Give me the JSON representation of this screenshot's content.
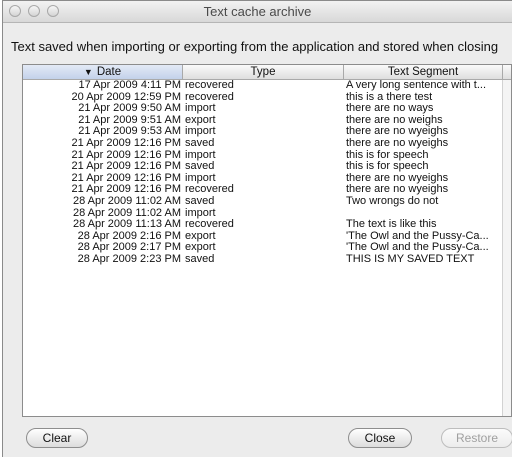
{
  "window": {
    "title": "Text cache archive"
  },
  "description": "Text saved when importing or exporting from the application and stored when closing",
  "table": {
    "columns": [
      "Date",
      "Type",
      "Text Segment"
    ],
    "sort_column": "Date",
    "rows": [
      {
        "date": "17 Apr 2009 4:11 PM",
        "type": "recovered",
        "text": "A very long sentence with t..."
      },
      {
        "date": "20 Apr 2009 12:59 PM",
        "type": "recovered",
        "text": "this is a there test"
      },
      {
        "date": "21 Apr 2009 9:50 AM",
        "type": "import",
        "text": "there are no ways"
      },
      {
        "date": "21 Apr 2009 9:51 AM",
        "type": "export",
        "text": "there are no weighs"
      },
      {
        "date": "21 Apr 2009 9:53 AM",
        "type": "import",
        "text": "there are no wyeighs"
      },
      {
        "date": "21 Apr 2009 12:16 PM",
        "type": "saved",
        "text": "there are no wyeighs"
      },
      {
        "date": "21 Apr 2009 12:16 PM",
        "type": "import",
        "text": "this is for speech"
      },
      {
        "date": "21 Apr 2009 12:16 PM",
        "type": "saved",
        "text": "this is for speech"
      },
      {
        "date": "21 Apr 2009 12:16 PM",
        "type": "import",
        "text": "there are no wyeighs"
      },
      {
        "date": "21 Apr 2009 12:16 PM",
        "type": "recovered",
        "text": "there are no wyeighs"
      },
      {
        "date": "28 Apr 2009 11:02 AM",
        "type": "saved",
        "text": "Two wrongs do not"
      },
      {
        "date": "28 Apr 2009 11:02 AM",
        "type": "import",
        "text": ""
      },
      {
        "date": "28 Apr 2009 11:13 AM",
        "type": "recovered",
        "text": "The text is like this"
      },
      {
        "date": "28 Apr 2009 2:16 PM",
        "type": "export",
        "text": "'The Owl and the Pussy-Ca..."
      },
      {
        "date": "28 Apr 2009 2:17 PM",
        "type": "export",
        "text": "'The Owl and the Pussy-Ca..."
      },
      {
        "date": "28 Apr 2009 2:23 PM",
        "type": "saved",
        "text": "THIS IS MY SAVED TEXT"
      }
    ]
  },
  "buttons": {
    "clear": "Clear",
    "close": "Close",
    "restore": "Restore"
  }
}
